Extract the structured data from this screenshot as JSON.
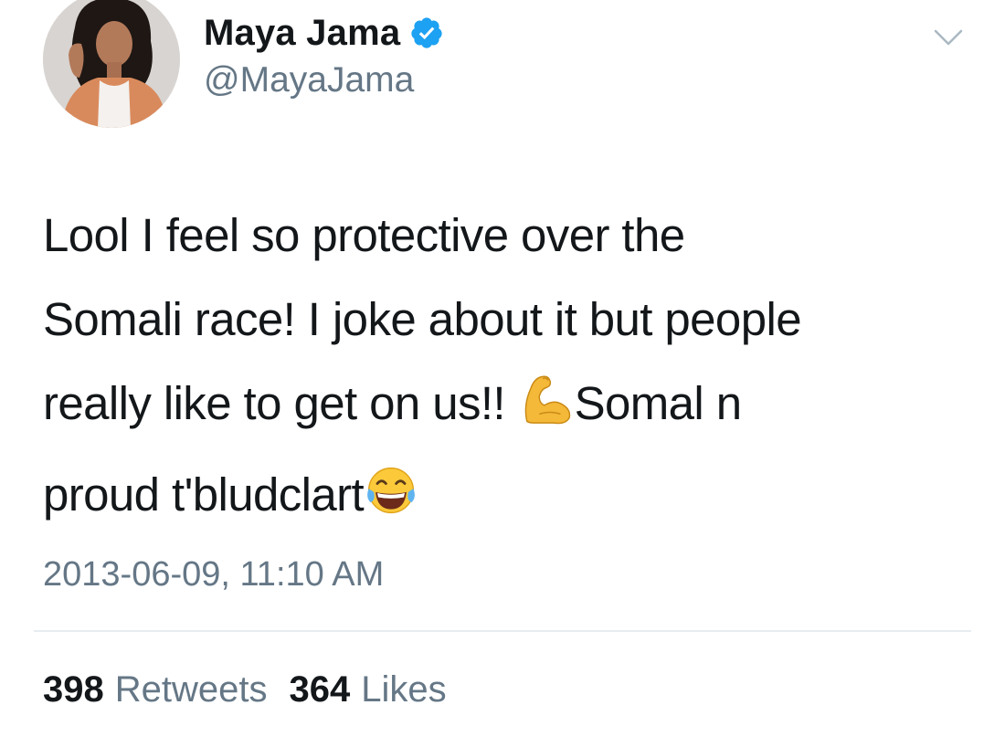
{
  "tweet": {
    "display_name": "Maya Jama",
    "handle": "@MayaJama",
    "verified": true,
    "text_lines": [
      "Lool I feel so protective over the",
      "Somali race! I joke about it but people",
      "really like to get on us!! ",
      "Somal n",
      "proud t'bludclart"
    ],
    "emojis": {
      "flexed_biceps": "flexed-biceps-icon",
      "tears_of_joy": "face-with-tears-of-joy-icon"
    },
    "timestamp": "2013-06-09, 11:10 AM",
    "stats": {
      "retweets_count": "398",
      "retweets_label": "Retweets",
      "likes_count": "364",
      "likes_label": "Likes"
    }
  },
  "colors": {
    "text_primary": "#14171a",
    "text_secondary": "#657786",
    "verified_blue": "#1da1f2",
    "divider": "#e6ecf0"
  }
}
